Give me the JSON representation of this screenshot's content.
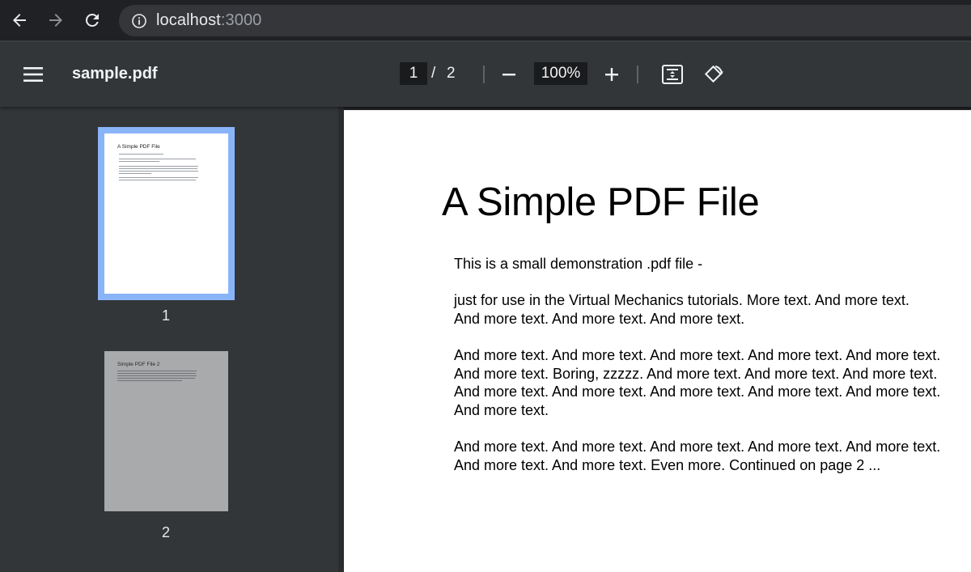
{
  "browser": {
    "url_host": "localhost",
    "url_port": ":3000"
  },
  "viewer": {
    "title": "sample.pdf",
    "current_page": "1",
    "page_separator": "/",
    "total_pages": "2",
    "zoom": "100%"
  },
  "thumbnails": [
    {
      "number": "1",
      "title": "A Simple PDF File",
      "selected": true
    },
    {
      "number": "2",
      "title": "Simple PDF File 2",
      "selected": false
    }
  ],
  "document": {
    "heading": "A Simple PDF File",
    "paragraphs": [
      "This is a small demonstration .pdf file -",
      "just for use in the Virtual Mechanics tutorials. More text. And more text. And more text. And more text. And more text.",
      "And more text. And more text. And more text. And more text. And more text. And more text. Boring, zzzzz. And more text. And more text. And more text. And more text. And more text. And more text. And more text. And more text. And more text.",
      "And more text. And more text. And more text. And more text. And more text. And more text. And more text. Even more. Continued on page 2 ..."
    ]
  },
  "colors": {
    "accent": "#8ab4f8",
    "toolbar": "#323639",
    "browser": "#202124"
  }
}
